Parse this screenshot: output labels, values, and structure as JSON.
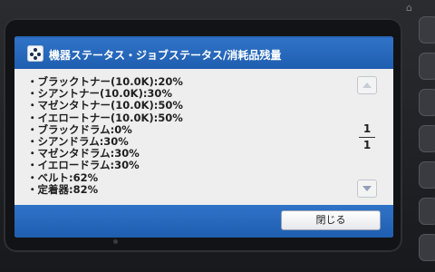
{
  "window": {
    "title": "機器ステータス・ジョブステータス/消耗品残量"
  },
  "consumables": [
    {
      "label": "・ブラックトナー(10.0K):20%"
    },
    {
      "label": "・シアントナー(10.0K):30%"
    },
    {
      "label": "・マゼンタトナー(10.0K):50%"
    },
    {
      "label": "・イエロートナー(10.0K):50%"
    },
    {
      "label": "・ブラックドラム:0%"
    },
    {
      "label": "・シアンドラム:30%"
    },
    {
      "label": "・マゼンタドラム:30%"
    },
    {
      "label": "・イエロードラム:30%"
    },
    {
      "label": "・ベルト:62%"
    },
    {
      "label": "・定着器:82%"
    }
  ],
  "pager": {
    "current": "1",
    "total": "1"
  },
  "footer": {
    "close_label": "閉じる"
  },
  "colors": {
    "titlebar": "#1f5eb0",
    "screen_bg": "#eeeeee",
    "text": "#202020"
  },
  "icons": {
    "title": "status-dots-icon",
    "scroll_up": "scroll-up-icon",
    "scroll_down": "scroll-down-icon"
  }
}
